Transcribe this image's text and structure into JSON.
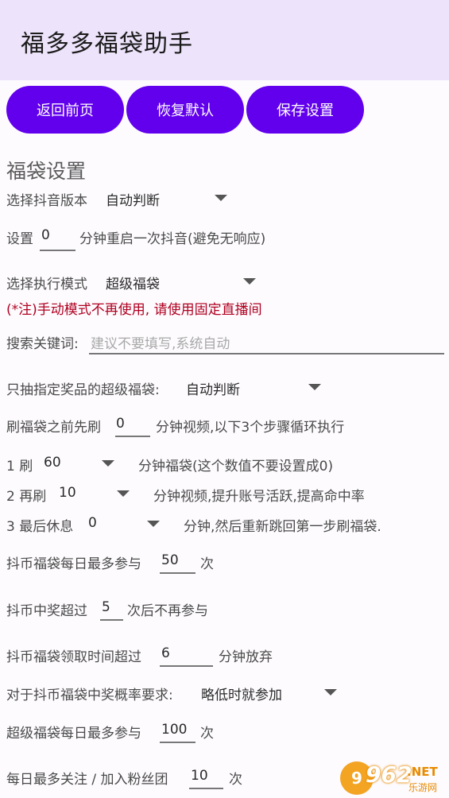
{
  "app_title": "福多多福袋助手",
  "buttons": {
    "back": "返回前页",
    "reset": "恢复默认",
    "save": "保存设置"
  },
  "section_title": "福袋设置",
  "douyin_version": {
    "label": "选择抖音版本",
    "value": "自动判断"
  },
  "restart": {
    "prefix": "设置",
    "value": "0",
    "suffix": "分钟重启一次抖音(避免无响应)"
  },
  "exec_mode": {
    "label": "选择执行模式",
    "value": "超级福袋"
  },
  "mode_note": "(*注)手动模式不再使用, 请使用固定直播间",
  "search": {
    "label": "搜索关键词:",
    "placeholder": "建议不要填写,系统自动"
  },
  "prize": {
    "label": "只抽指定奖品的超级福袋:",
    "value": "自动判断"
  },
  "pre_video": {
    "prefix": "刷福袋之前先刷",
    "value": "0",
    "suffix": "分钟视频,以下3个步骤循环执行"
  },
  "step1": {
    "label": "1 刷",
    "value": "60",
    "suffix": "分钟福袋(这个数值不要设置成0)"
  },
  "step2": {
    "label": "2 再刷",
    "value": "10",
    "suffix": "分钟视频,提升账号活跃,提高命中率"
  },
  "step3": {
    "label": "3 最后休息",
    "value": "0",
    "suffix": "分钟,然后重新跳回第一步刷福袋."
  },
  "coin_daily": {
    "prefix": "抖币福袋每日最多参与",
    "value": "50",
    "suffix": "次"
  },
  "coin_win": {
    "prefix": "抖币中奖超过",
    "value": "5",
    "suffix": "次后不再参与"
  },
  "coin_timeout": {
    "prefix": "抖币福袋领取时间超过",
    "value": "6",
    "suffix": "分钟放弃"
  },
  "coin_prob": {
    "label": "对于抖币福袋中奖概率要求:",
    "value": "略低时就参加"
  },
  "super_daily": {
    "prefix": "超级福袋每日最多参与",
    "value": "100",
    "suffix": "次"
  },
  "follow_daily": {
    "prefix": "每日最多关注 / 加入粉丝团",
    "value": "10",
    "suffix": "次"
  },
  "watermark": {
    "badge": "9",
    "number": "962",
    "domain": ".NET",
    "site": "乐游网"
  },
  "colors": {
    "primary": "#6200ee",
    "appbar": "#ede3fa",
    "note": "#b00020"
  }
}
